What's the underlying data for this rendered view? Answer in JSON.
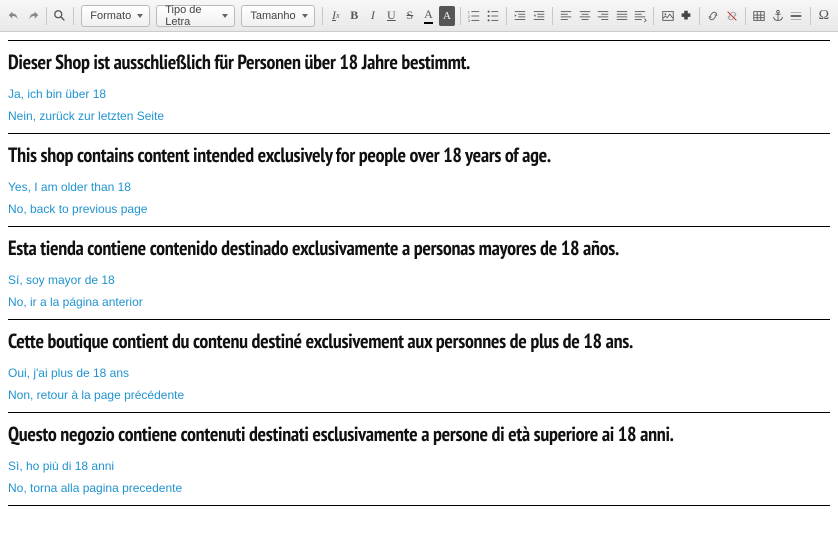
{
  "toolbar": {
    "dropdowns": {
      "format": "Formato",
      "font": "Tipo de Letra",
      "size": "Tamanho"
    }
  },
  "sections": [
    {
      "heading": "Dieser Shop ist ausschließlich für Personen über 18 Jahre bestimmt.",
      "yes": "Ja, ich bin über 18",
      "no": "Nein, zurück zur letzten Seite"
    },
    {
      "heading": "This shop contains content intended exclusively for people over 18 years of age.",
      "yes": "Yes, I am older than 18",
      "no": "No, back to previous page"
    },
    {
      "heading": "Esta tienda contiene contenido destinado exclusivamente a personas mayores de 18 años.",
      "yes": "Sí, soy mayor de 18",
      "no": "No, ir a la página anterior"
    },
    {
      "heading": "Cette boutique contient du contenu destiné exclusivement aux personnes de plus de 18 ans.",
      "yes": "Oui, j'ai plus de 18 ans",
      "no": "Non, retour à la page précédente"
    },
    {
      "heading": "Questo negozio contiene contenuti destinati esclusivamente a persone di età superiore ai 18 anni.",
      "yes": "Sì, ho più di 18 anni",
      "no": "No, torna alla pagina precedente"
    }
  ]
}
